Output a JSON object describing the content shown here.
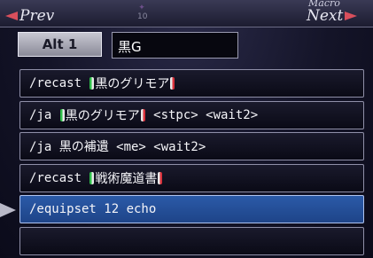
{
  "header": {
    "macro_label": "Macro",
    "emblem_number": "10",
    "prev_label": "Prev",
    "next_label": "Next"
  },
  "alt_button_label": "Alt 1",
  "macro_name": "黒G",
  "lines": [
    {
      "prefix": "/recast ",
      "auto": "黒のグリモア",
      "suffix": ""
    },
    {
      "prefix": "/ja ",
      "auto": "黒のグリモア",
      "suffix": " <stpc> <wait2>"
    },
    {
      "prefix": "/ja 黒の補遺 <me> <wait2>",
      "auto": "",
      "suffix": ""
    },
    {
      "prefix": "/recast ",
      "auto": "戦術魔道書",
      "suffix": ""
    },
    {
      "prefix": "/equipset 12 echo",
      "auto": "",
      "suffix": ""
    },
    {
      "prefix": "",
      "auto": "",
      "suffix": ""
    }
  ],
  "selected_line": 4,
  "colors": {
    "selected": "#2b5aa8",
    "prev_next_arrow": "#d94f5c",
    "auto_open": "#2fbf4a",
    "auto_close": "#d8323c"
  }
}
